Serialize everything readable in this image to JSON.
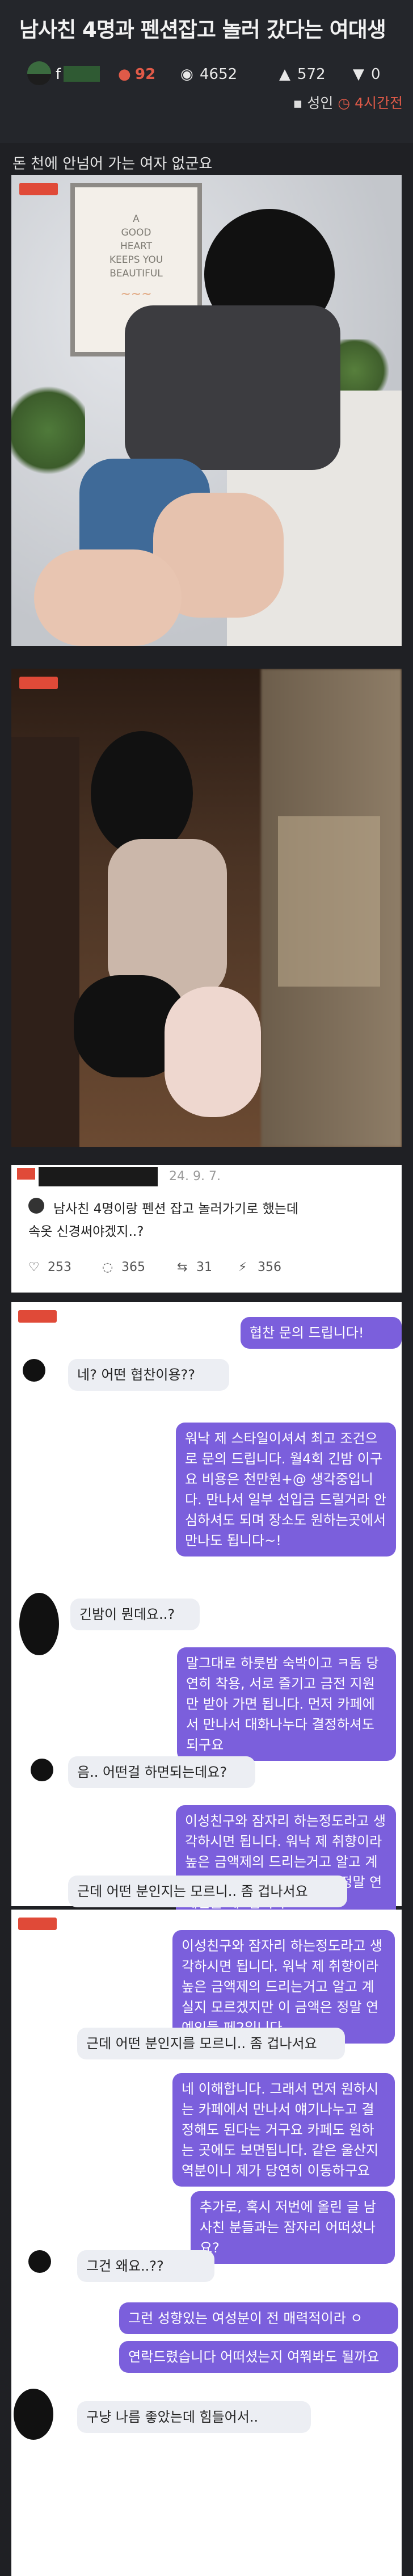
{
  "post": {
    "title": "남사친 4명과 펜션잡고 놀러 갔다는 여대생",
    "author_initial": "f",
    "comments": "92",
    "views": "4652",
    "likes": "572",
    "dislikes": "0",
    "category": "성인",
    "time": "4시간전",
    "intro": "돈 천에 안넘어 가는 여자 없군요"
  },
  "photo1": {
    "frame_text": [
      "A",
      "GOOD",
      "HEART",
      "KEEPS YOU",
      "BEAUTIFUL"
    ]
  },
  "tweet": {
    "date": "24. 9. 7.",
    "text_1": "남사친 4명이랑 펜션 잡고 놀러가기로 했는데",
    "text_2": "속옷 신경써야겠지..?",
    "likes": "253",
    "replies": "365",
    "retweets": "31",
    "views": "356"
  },
  "chat1": [
    {
      "side": "out",
      "text": "협찬 문의 드립니다!"
    },
    {
      "side": "in",
      "text": "네? 어떤 협찬이용??"
    },
    {
      "side": "out",
      "text": "워낙 제 스타일이셔서 최고 조건으로 문의 드립니다. 월4회 긴밤 이구요 비용은 천만원+@ 생각중입니다. 만나서 일부 선입금 드릴거라 안심하셔도 되며 장소도 원하는곳에서 만나도 됩니다~!"
    },
    {
      "side": "in",
      "text": "긴밤이 뭔데요..?"
    },
    {
      "side": "out",
      "text": "말그대로 하룻밤 숙박이고 ㅋ돔 당연히 착용, 서로 즐기고 금전 지원만 받아 가면 됩니다. 먼저 카페에서 만나서 대화나누다 결정하셔도 되구요"
    },
    {
      "side": "in",
      "text": "음.. 어떤걸 하면되는데요?"
    },
    {
      "side": "out",
      "text": "이성친구와 잠자리 하는정도라고 생각하시면 됩니다. 워낙 제 취향이라 높은 금액제의 드리는거고 알고 계실지 모르겠지만 이 금액은 정말 연예인들 페2입니다."
    },
    {
      "side": "in",
      "text": "근데 어떤 분인지는 모르니.. 좀 겁나서요"
    }
  ],
  "chat2": [
    {
      "side": "out",
      "text": "이성친구와 잠자리 하는정도라고 생각하시면 됩니다. 워낙 제 취향이라 높은 금액제의 드리는거고 알고 계실지 모르겠지만 이 금액은 정말 연예인들 페2입니다."
    },
    {
      "side": "in",
      "text": "근데 어떤 분인지를 모르니.. 좀 겁나서요"
    },
    {
      "side": "out",
      "text": "네 이해합니다. 그래서 먼저 원하시는 카페에서 만나서 얘기나누고 결정해도 된다는 거구요 카페도 원하는 곳에도 보면됩니다. 같은 울산지역분이니 제가 당연히 이동하구요"
    },
    {
      "side": "out",
      "text": "추가로, 혹시 저번에 올린 글 남사친 분들과는 잠자리 어떠셨나요?"
    },
    {
      "side": "in",
      "text": "그건 왜요..??"
    },
    {
      "side": "out",
      "text": "그런 성향있는 여성분이 전 매력적이라 ㅇ"
    },
    {
      "side": "out",
      "text": "연락드렸습니다 어떠셨는지 여쭤봐도 될까요"
    },
    {
      "side": "in",
      "text": "구냥 나름 좋았는데 힘들어서.."
    }
  ]
}
